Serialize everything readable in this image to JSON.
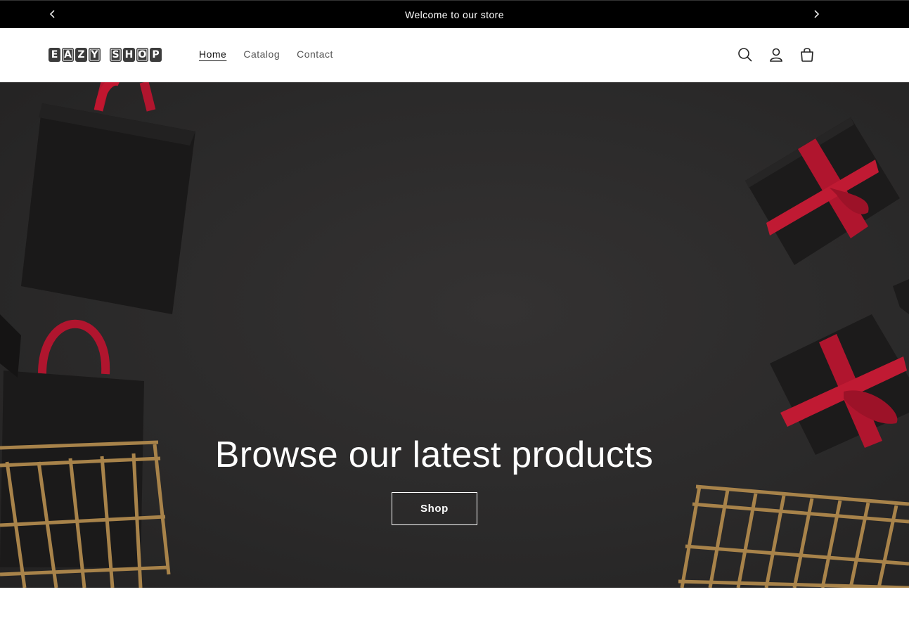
{
  "announcement": {
    "text": "Welcome to our store",
    "prev_icon": "chevron-left-icon",
    "next_icon": "chevron-right-icon"
  },
  "header": {
    "logo_letters": [
      "E",
      "A",
      "Z",
      "Y",
      "S",
      "H",
      "O",
      "P"
    ],
    "logo_alt": "EAZY SHOP",
    "nav": [
      {
        "label": "Home",
        "active": true
      },
      {
        "label": "Catalog",
        "active": false
      },
      {
        "label": "Contact",
        "active": false
      }
    ],
    "icons": [
      "search-icon",
      "account-icon",
      "cart-icon"
    ]
  },
  "hero": {
    "title": "Browse our latest products",
    "button_label": "Shop"
  },
  "colors": {
    "announcement_bg": "#000000",
    "hero_bg": "#2b2a2a",
    "ribbon": "#b0152e",
    "basket": "#b08a4e"
  }
}
